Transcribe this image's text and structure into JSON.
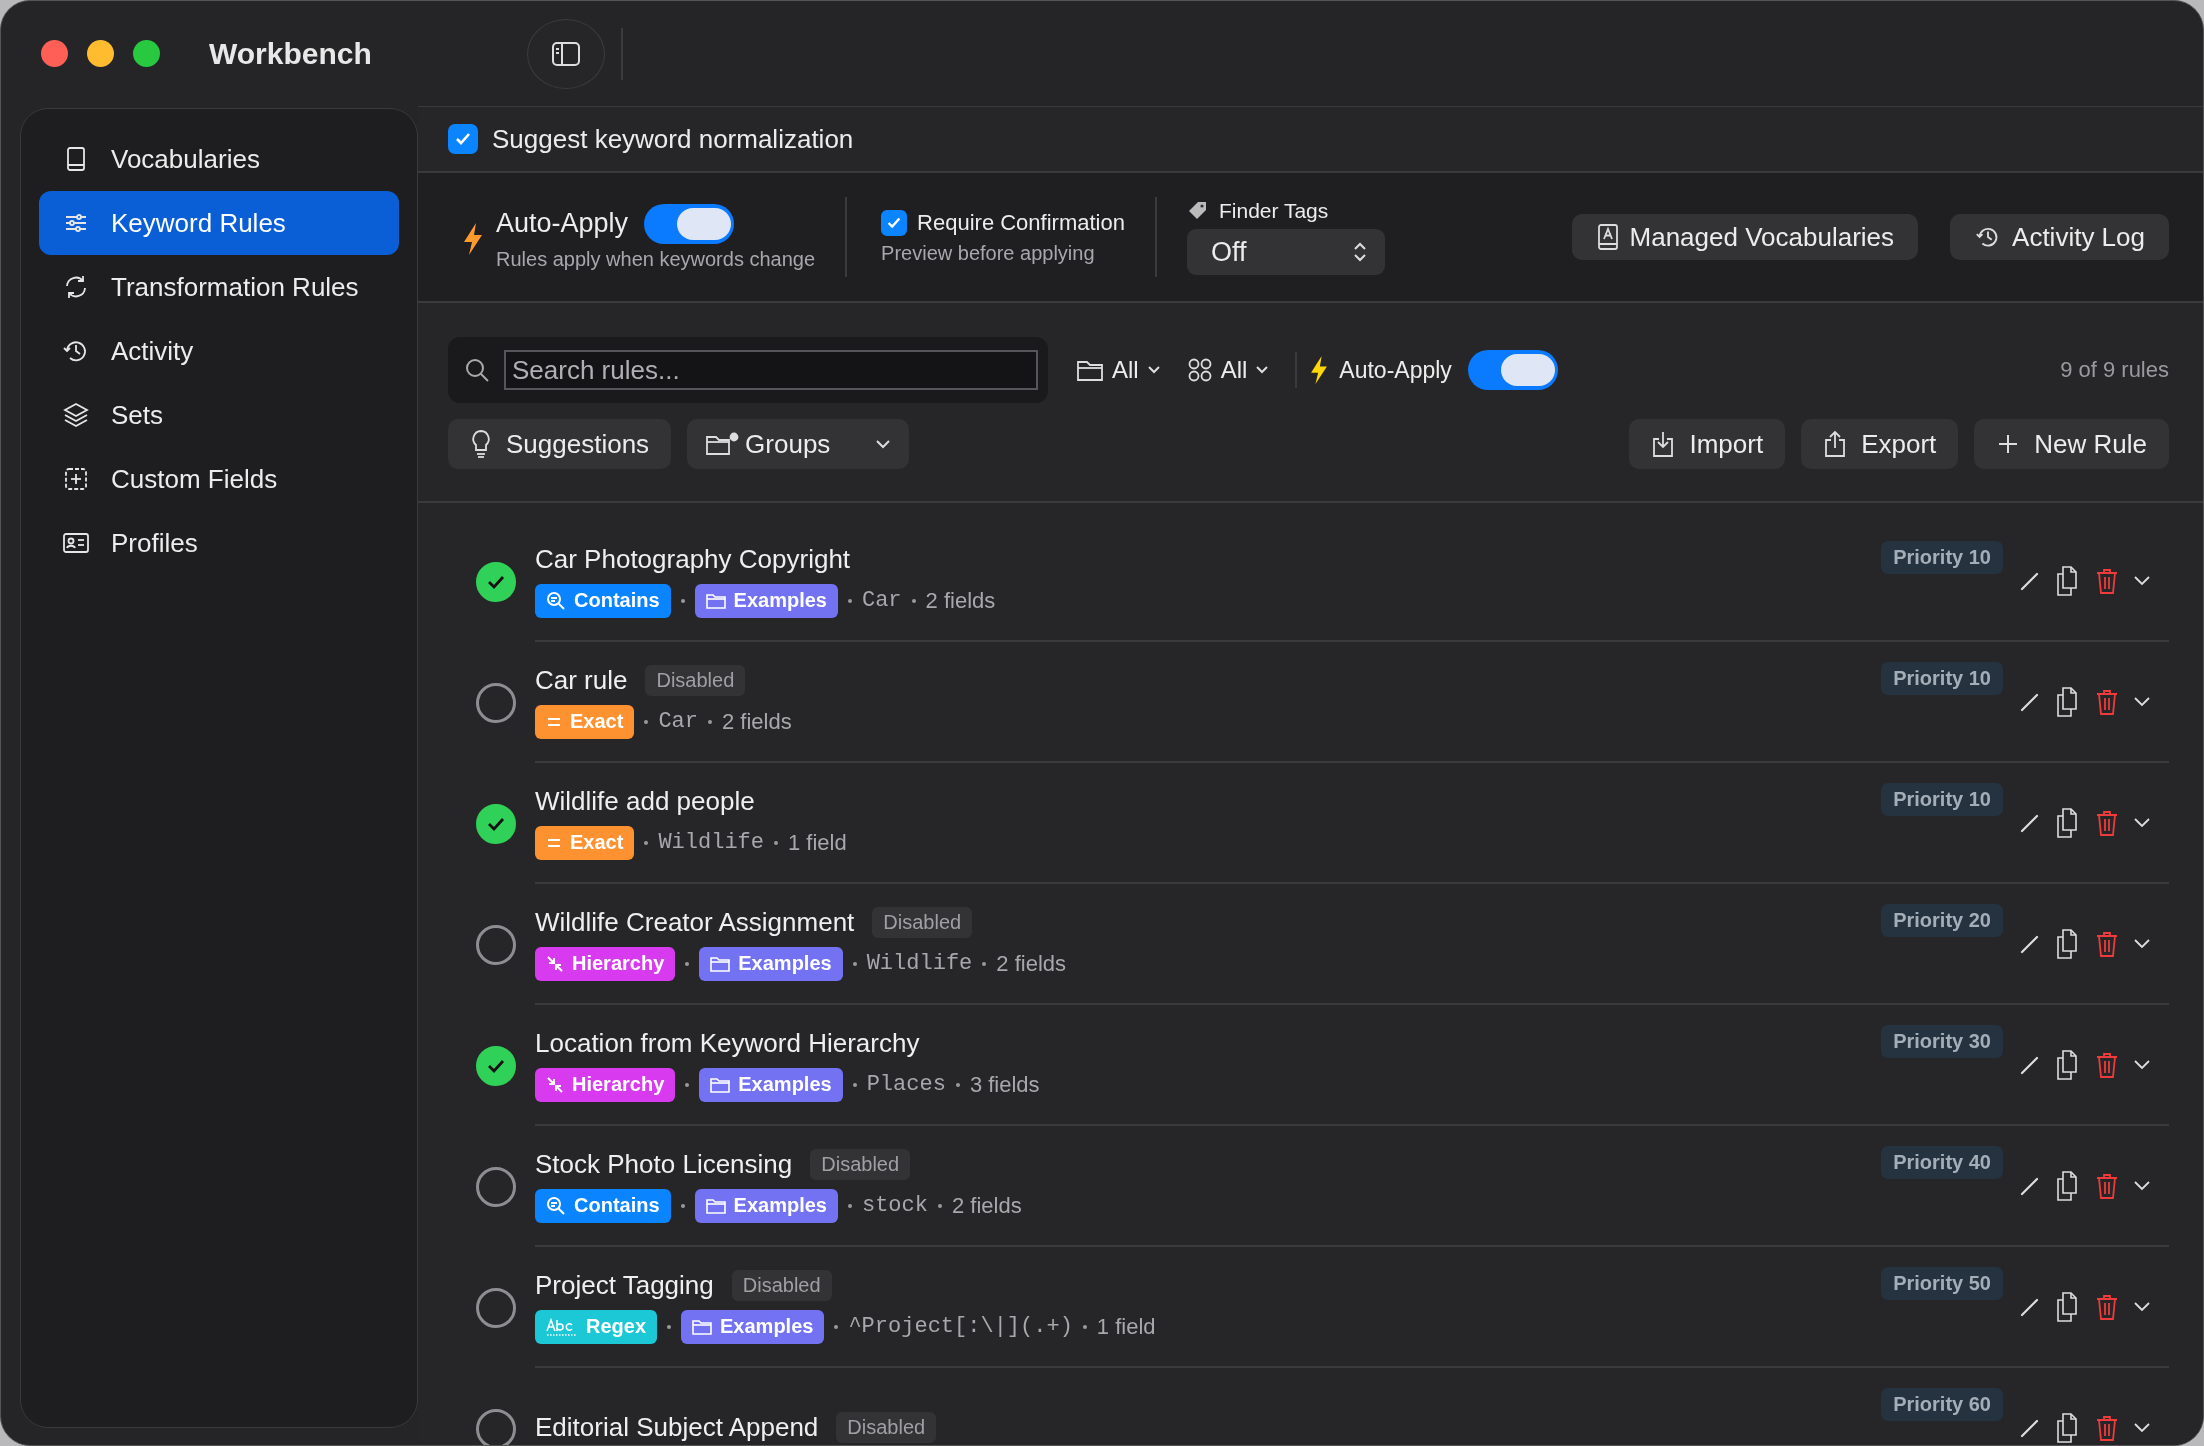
{
  "window": {
    "title": "Workbench"
  },
  "sidebar": {
    "items": [
      {
        "label": "Vocabularies",
        "selected": false
      },
      {
        "label": "Keyword Rules",
        "selected": true
      },
      {
        "label": "Transformation Rules",
        "selected": false
      },
      {
        "label": "Activity",
        "selected": false
      },
      {
        "label": "Sets",
        "selected": false
      },
      {
        "label": "Custom Fields",
        "selected": false
      },
      {
        "label": "Profiles",
        "selected": false
      }
    ]
  },
  "suggest": {
    "label": "Suggest keyword normalization",
    "checked": true
  },
  "settings": {
    "auto_apply": {
      "label": "Auto-Apply",
      "description": "Rules apply when keywords change",
      "on": true
    },
    "require_confirmation": {
      "label": "Require Confirmation",
      "description": "Preview before applying",
      "checked": true
    },
    "finder_tags": {
      "label": "Finder Tags",
      "value": "Off"
    },
    "buttons": [
      "Managed Vocabularies",
      "Activity Log"
    ]
  },
  "filters": {
    "search": {
      "placeholder": "Search rules..."
    },
    "group_filter": "All",
    "type_filter": "All",
    "auto_apply": {
      "label": "Auto-Apply",
      "on": true
    },
    "count": "9 of 9 rules",
    "suggestions": "Suggestions",
    "groups": "Groups",
    "actions": [
      "Import",
      "Export",
      "New Rule"
    ]
  },
  "rules": [
    {
      "title": "Car Photography Copyright",
      "enabled": true,
      "tags": [
        {
          "kind": "contains",
          "label": "Contains",
          "color": "#0a84ff"
        },
        {
          "kind": "group",
          "label": "Examples",
          "color": "#7272f2"
        }
      ],
      "keyword": "Car",
      "fields": "2 fields",
      "priority": "Priority 10"
    },
    {
      "title": "Car rule",
      "enabled": false,
      "badge": "Disabled",
      "tags": [
        {
          "kind": "exact",
          "label": "Exact",
          "color": "#ff9230"
        }
      ],
      "keyword": "Car",
      "fields": "2 fields",
      "priority": "Priority 10"
    },
    {
      "title": "Wildlife add people",
      "enabled": true,
      "tags": [
        {
          "kind": "exact",
          "label": "Exact",
          "color": "#ff9230"
        }
      ],
      "keyword": "Wildlife",
      "fields": "1 field",
      "priority": "Priority 10"
    },
    {
      "title": "Wildlife Creator Assignment",
      "enabled": false,
      "badge": "Disabled",
      "tags": [
        {
          "kind": "hierarchy",
          "label": "Hierarchy",
          "color": "#d83af0"
        },
        {
          "kind": "group",
          "label": "Examples",
          "color": "#7272f2"
        }
      ],
      "keyword": "Wildlife",
      "fields": "2 fields",
      "priority": "Priority 20"
    },
    {
      "title": "Location from Keyword Hierarchy",
      "enabled": true,
      "tags": [
        {
          "kind": "hierarchy",
          "label": "Hierarchy",
          "color": "#d83af0"
        },
        {
          "kind": "group",
          "label": "Examples",
          "color": "#7272f2"
        }
      ],
      "keyword": "Places",
      "fields": "3 fields",
      "priority": "Priority 30"
    },
    {
      "title": "Stock Photo Licensing",
      "enabled": false,
      "badge": "Disabled",
      "tags": [
        {
          "kind": "contains",
          "label": "Contains",
          "color": "#0a84ff"
        },
        {
          "kind": "group",
          "label": "Examples",
          "color": "#7272f2"
        }
      ],
      "keyword": "stock",
      "fields": "2 fields",
      "priority": "Priority 40"
    },
    {
      "title": "Project Tagging",
      "enabled": false,
      "badge": "Disabled",
      "tags": [
        {
          "kind": "regex",
          "label": "Regex",
          "color": "#1cc8d6"
        },
        {
          "kind": "group",
          "label": "Examples",
          "color": "#7272f2"
        }
      ],
      "keyword": "^Project[:\\|](.+)",
      "fields": "1 field",
      "priority": "Priority 50"
    },
    {
      "title": "Editorial Subject Append",
      "enabled": false,
      "badge": "Disabled",
      "priority": "Priority 60"
    }
  ]
}
